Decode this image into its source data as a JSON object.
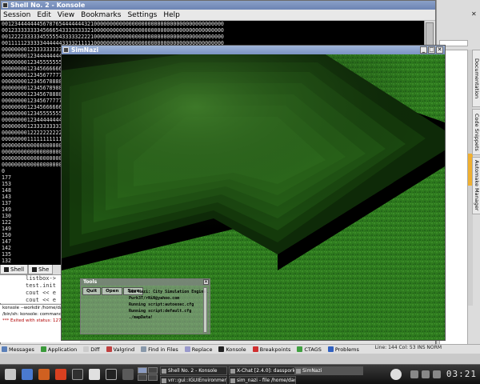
{
  "konsole": {
    "title": "Shell No. 2 - Konsole",
    "menu": [
      "Session",
      "Edit",
      "View",
      "Bookmarks",
      "Settings",
      "Help"
    ],
    "terminal_lines": [
      "0012344444445678765444444432100000000000000000000000000000000000000000",
      "0012333333334566654333333332100000000000000000000000000000000000000000",
      "0012222333334555554333332222100000000000000000000000000000000000000000",
      "0011111233333444444333321111100000000000000000000000000000000000000000",
      "0000000012333333333333210000000000000000000000000000000000000000000000",
      "0000000012344444444",
      "0000000012345555555",
      "0000000012345666666",
      "0000000012345677777",
      "0000000012345678888",
      "0000000012345678988",
      "0000000012345678888",
      "0000000012345677777",
      "0000000012345666666",
      "0000000012345555555",
      "0000000012344444444",
      "0000000012333333333",
      "0000000012222222222",
      "0000000011111111111",
      "0000000000000000000",
      "0000000000000000000",
      "0000000000000000000",
      "0000000000000000000",
      "0",
      "177",
      "153",
      "148",
      "143",
      "137",
      "149",
      "130",
      "122",
      "149",
      "150",
      "147",
      "142",
      "135",
      "132",
      "135",
      "109",
      "]"
    ],
    "tabs": [
      {
        "label": "Shell"
      },
      {
        "label": "She"
      }
    ],
    "editor_lines": [
      "listbox->",
      "test.init",
      "cout << e",
      "cout << e"
    ],
    "output_lines": [
      {
        "text": "konsole --workdir /home/dac",
        "err": false
      },
      {
        "text": "/bin/sh: konsole: command n",
        "err": false
      },
      {
        "text": "*** Exited with status: 127 ***",
        "err": true
      }
    ]
  },
  "sidebar": {
    "tabs": [
      "Documentation",
      "Code Snippets",
      "Automake Manager"
    ]
  },
  "tooltabs": [
    {
      "label": "Messages",
      "icon": "messages-icon",
      "color": "#5a7fb8"
    },
    {
      "label": "Application",
      "icon": "application-icon",
      "color": "#3a9a3a"
    },
    {
      "label": "Diff",
      "icon": "diff-icon",
      "color": "#cccccc"
    },
    {
      "label": "Valgrind",
      "icon": "valgrind-icon",
      "color": "#c04040"
    },
    {
      "label": "Find in Files",
      "icon": "find-icon",
      "color": "#8899aa"
    },
    {
      "label": "Replace",
      "icon": "replace-icon",
      "color": "#9999cc"
    },
    {
      "label": "Konsole",
      "icon": "konsole-icon",
      "color": "#222222"
    },
    {
      "label": "Breakpoints",
      "icon": "breakpoints-icon",
      "color": "#d03030"
    },
    {
      "label": "CTAGS",
      "icon": "ctags-icon",
      "color": "#40a040"
    },
    {
      "label": "Problems",
      "icon": "problems-icon",
      "color": "#3060c0"
    }
  ],
  "status": {
    "text": "Line: 144 Col: 53  INS  NORM"
  },
  "simwin": {
    "title": "SimNazi"
  },
  "tools": {
    "title": "Tools",
    "buttons": [
      "Quit",
      "Open",
      "Save"
    ],
    "log": [
      "Sim Nazi: City Simulation Engine.",
      "Purk3T/rNiN@yahoo.com",
      "Running script:autoexec.cfg",
      "Running script:default.cfg",
      "./mapData!"
    ]
  },
  "taskbar": {
    "tasks": [
      {
        "label": "Shell No. 2 - Konsole",
        "active": false
      },
      {
        "label": "X-Chat [2.4.0]: dasspork @",
        "active": false
      },
      {
        "label": "SimNazi",
        "active": true
      },
      {
        "label": "vrr::gui::IGUIEnvironment c",
        "active": false
      },
      {
        "label": "sim_nazi - file /home/dac",
        "active": false
      }
    ],
    "clock": "03:21"
  }
}
